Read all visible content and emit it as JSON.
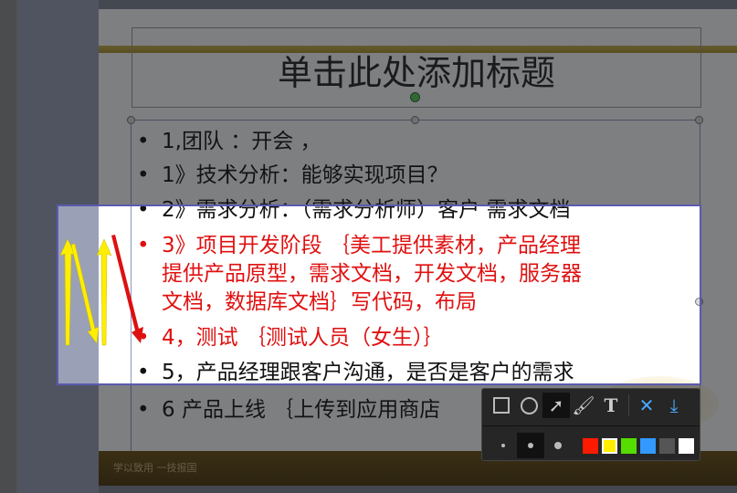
{
  "slide": {
    "title": "单击此处添加标题",
    "bullets": [
      {
        "text": "1,团队 ：开会 ，",
        "color": "black"
      },
      {
        "text": "1》技术分析：能够实现项目？",
        "color": "black"
      },
      {
        "text": "2》需求分析：（需求分析师）客户 需求文档",
        "color": "black"
      },
      {
        "text": "3》项目开发阶段 ｛美工提供素材，产品经理",
        "color": "red",
        "cont": [
          "提供产品原型，需求文档，开发文档，服务器",
          "文档，数据库文档｝写代码，布局"
        ]
      },
      {
        "text": "4，测试 ｛测试人员（女生）｝",
        "color": "red"
      },
      {
        "text": "5，产品经理跟客户沟通，是否是客户的需求",
        "color": "black"
      },
      {
        "text": "6 产品上线 ｛上传到应用商店",
        "color": "black"
      }
    ],
    "bullet_char": "•",
    "footer": "学以致用 一技报国"
  },
  "annotations": {
    "arrows": [
      "yellow-up",
      "yellow-down",
      "yellow-up",
      "red-down"
    ],
    "colors": {
      "yellow": "#ffee00",
      "red": "#dd1010"
    }
  },
  "toolbar": {
    "tools": [
      "rectangle-icon",
      "ellipse-icon",
      "arrow-icon",
      "brush-icon",
      "text-icon",
      "cancel-icon",
      "save-icon"
    ],
    "active_tool": "arrow-icon",
    "sizes": [
      "small",
      "medium",
      "large"
    ],
    "active_size": "medium",
    "palette": [
      "#ff1a00",
      "#ffee00",
      "#55dd00",
      "#3399ff",
      "#555555",
      "#ffffff"
    ],
    "active_color": "#ffee00"
  }
}
